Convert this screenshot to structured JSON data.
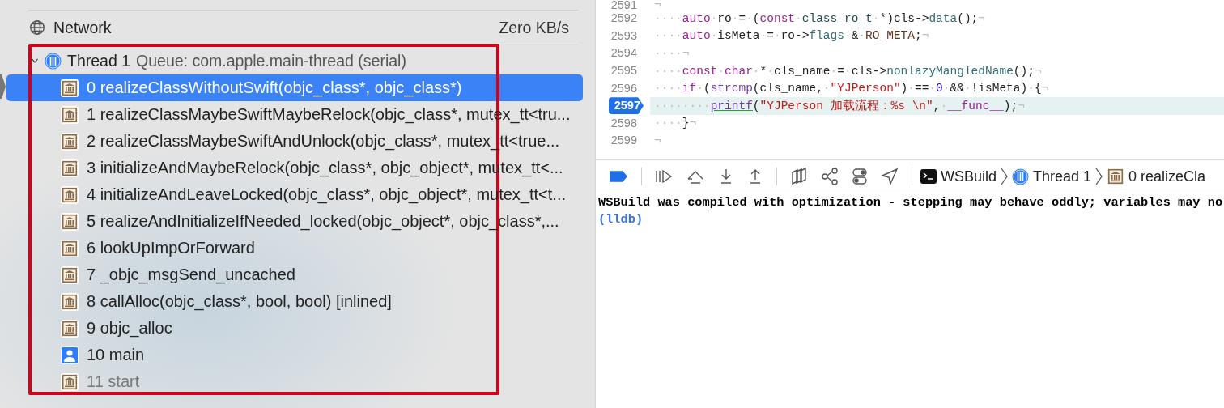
{
  "navigator": {
    "network": {
      "label": "Network",
      "value": "Zero KB/s"
    },
    "thread": {
      "title": "Thread 1",
      "queue": "Queue: com.apple.main-thread (serial)",
      "expanded": true
    },
    "frames": [
      {
        "kind": "library",
        "label": "0 realizeClassWithoutSwift(objc_class*, objc_class*)",
        "selected": true,
        "dimmed": false
      },
      {
        "kind": "library",
        "label": "1 realizeClassMaybeSwiftMaybeRelock(objc_class*, mutex_tt<tru...",
        "selected": false,
        "dimmed": false
      },
      {
        "kind": "library",
        "label": "2 realizeClassMaybeSwiftAndUnlock(objc_class*, mutex_tt<true...",
        "selected": false,
        "dimmed": false
      },
      {
        "kind": "library",
        "label": "3 initializeAndMaybeRelock(objc_class*, objc_object*, mutex_tt<...",
        "selected": false,
        "dimmed": false
      },
      {
        "kind": "library",
        "label": "4 initializeAndLeaveLocked(objc_class*, objc_object*, mutex_tt<t...",
        "selected": false,
        "dimmed": false
      },
      {
        "kind": "library",
        "label": "5 realizeAndInitializeIfNeeded_locked(objc_object*, objc_class*,...",
        "selected": false,
        "dimmed": false
      },
      {
        "kind": "library",
        "label": "6 lookUpImpOrForward",
        "selected": false,
        "dimmed": false
      },
      {
        "kind": "library",
        "label": "7 _objc_msgSend_uncached",
        "selected": false,
        "dimmed": false
      },
      {
        "kind": "library",
        "label": "8 callAlloc(objc_class*, bool, bool) [inlined]",
        "selected": false,
        "dimmed": false
      },
      {
        "kind": "library",
        "label": "9 objc_alloc",
        "selected": false,
        "dimmed": false
      },
      {
        "kind": "user",
        "label": "10 main",
        "selected": false,
        "dimmed": false
      },
      {
        "kind": "library",
        "label": "11 start",
        "selected": false,
        "dimmed": true
      }
    ]
  },
  "editor": {
    "lines": [
      {
        "number": "2591",
        "current": false,
        "tokens": [
          {
            "kind": "ws",
            "text": "¬"
          }
        ]
      },
      {
        "number": "2592",
        "current": false,
        "tokens": [
          {
            "kind": "ws",
            "text": "····"
          },
          {
            "kind": "kw",
            "text": "auto"
          },
          {
            "kind": "ws",
            "text": "·"
          },
          {
            "kind": "plain",
            "text": "ro"
          },
          {
            "kind": "ws",
            "text": "·"
          },
          {
            "kind": "plain",
            "text": "="
          },
          {
            "kind": "ws",
            "text": "·"
          },
          {
            "kind": "plain",
            "text": "("
          },
          {
            "kind": "kw",
            "text": "const"
          },
          {
            "kind": "ws",
            "text": "·"
          },
          {
            "kind": "type",
            "text": "class_ro_t"
          },
          {
            "kind": "ws",
            "text": "·"
          },
          {
            "kind": "plain",
            "text": "*)cls->"
          },
          {
            "kind": "member",
            "text": "data"
          },
          {
            "kind": "plain",
            "text": "();"
          },
          {
            "kind": "ws",
            "text": "¬"
          }
        ]
      },
      {
        "number": "2593",
        "current": false,
        "tokens": [
          {
            "kind": "ws",
            "text": "····"
          },
          {
            "kind": "kw",
            "text": "auto"
          },
          {
            "kind": "ws",
            "text": "·"
          },
          {
            "kind": "plain",
            "text": "isMeta"
          },
          {
            "kind": "ws",
            "text": "·"
          },
          {
            "kind": "plain",
            "text": "="
          },
          {
            "kind": "ws",
            "text": "·"
          },
          {
            "kind": "plain",
            "text": "ro->"
          },
          {
            "kind": "member",
            "text": "flags"
          },
          {
            "kind": "ws",
            "text": "·"
          },
          {
            "kind": "plain",
            "text": "&"
          },
          {
            "kind": "ws",
            "text": "·"
          },
          {
            "kind": "macro",
            "text": "RO_META"
          },
          {
            "kind": "plain",
            "text": ";"
          },
          {
            "kind": "ws",
            "text": "¬"
          }
        ]
      },
      {
        "number": "2594",
        "current": false,
        "tokens": [
          {
            "kind": "ws",
            "text": "····¬"
          }
        ]
      },
      {
        "number": "2595",
        "current": false,
        "tokens": [
          {
            "kind": "ws",
            "text": "····"
          },
          {
            "kind": "kw",
            "text": "const"
          },
          {
            "kind": "ws",
            "text": "·"
          },
          {
            "kind": "kw",
            "text": "char"
          },
          {
            "kind": "ws",
            "text": "·"
          },
          {
            "kind": "plain",
            "text": "*"
          },
          {
            "kind": "ws",
            "text": "·"
          },
          {
            "kind": "plain",
            "text": "cls_name"
          },
          {
            "kind": "ws",
            "text": "·"
          },
          {
            "kind": "plain",
            "text": "="
          },
          {
            "kind": "ws",
            "text": "·"
          },
          {
            "kind": "plain",
            "text": "cls->"
          },
          {
            "kind": "member",
            "text": "nonlazyMangledName"
          },
          {
            "kind": "plain",
            "text": "();"
          },
          {
            "kind": "ws",
            "text": "¬"
          }
        ]
      },
      {
        "number": "2596",
        "current": false,
        "tokens": [
          {
            "kind": "ws",
            "text": "····"
          },
          {
            "kind": "kw",
            "text": "if"
          },
          {
            "kind": "ws",
            "text": "·"
          },
          {
            "kind": "plain",
            "text": "("
          },
          {
            "kind": "libfn",
            "text": "strcmp"
          },
          {
            "kind": "plain",
            "text": "(cls_name,"
          },
          {
            "kind": "ws",
            "text": "·"
          },
          {
            "kind": "str",
            "text": "\"YJPerson\""
          },
          {
            "kind": "plain",
            "text": ")"
          },
          {
            "kind": "ws",
            "text": "·"
          },
          {
            "kind": "plain",
            "text": "=="
          },
          {
            "kind": "ws",
            "text": "·"
          },
          {
            "kind": "num",
            "text": "0"
          },
          {
            "kind": "ws",
            "text": "·"
          },
          {
            "kind": "plain",
            "text": "&&"
          },
          {
            "kind": "ws",
            "text": "·"
          },
          {
            "kind": "plain",
            "text": "!isMeta)"
          },
          {
            "kind": "ws",
            "text": "·"
          },
          {
            "kind": "plain",
            "text": "{"
          },
          {
            "kind": "ws",
            "text": "¬"
          }
        ]
      },
      {
        "number": "2597",
        "current": true,
        "tokens": [
          {
            "kind": "ws",
            "text": "········"
          },
          {
            "kind": "link",
            "text": "printf"
          },
          {
            "kind": "plain",
            "text": "("
          },
          {
            "kind": "str",
            "text": "\"YJPerson 加载流程：%s \\n\""
          },
          {
            "kind": "plain",
            "text": ","
          },
          {
            "kind": "ws",
            "text": "·"
          },
          {
            "kind": "kw",
            "text": "__func__"
          },
          {
            "kind": "plain",
            "text": ");"
          },
          {
            "kind": "ws",
            "text": "¬"
          }
        ]
      },
      {
        "number": "2598",
        "current": false,
        "tokens": [
          {
            "kind": "ws",
            "text": "····"
          },
          {
            "kind": "plain",
            "text": "}"
          },
          {
            "kind": "ws",
            "text": "¬"
          }
        ]
      },
      {
        "number": "2599",
        "current": false,
        "tokens": [
          {
            "kind": "ws",
            "text": "¬"
          }
        ]
      }
    ]
  },
  "debug_bar": {
    "breakpoints_active": true,
    "breadcrumbs": [
      {
        "kind": "terminal",
        "label": "WSBuild"
      },
      {
        "kind": "thread",
        "label": "Thread 1"
      },
      {
        "kind": "library",
        "label": "0 realizeCla"
      }
    ]
  },
  "console": {
    "lines": [
      {
        "kind": "output",
        "text": "WSBuild was compiled with optimization - stepping may behave oddly; variables may no"
      },
      {
        "kind": "prompt",
        "text": "(lldb)"
      }
    ]
  }
}
